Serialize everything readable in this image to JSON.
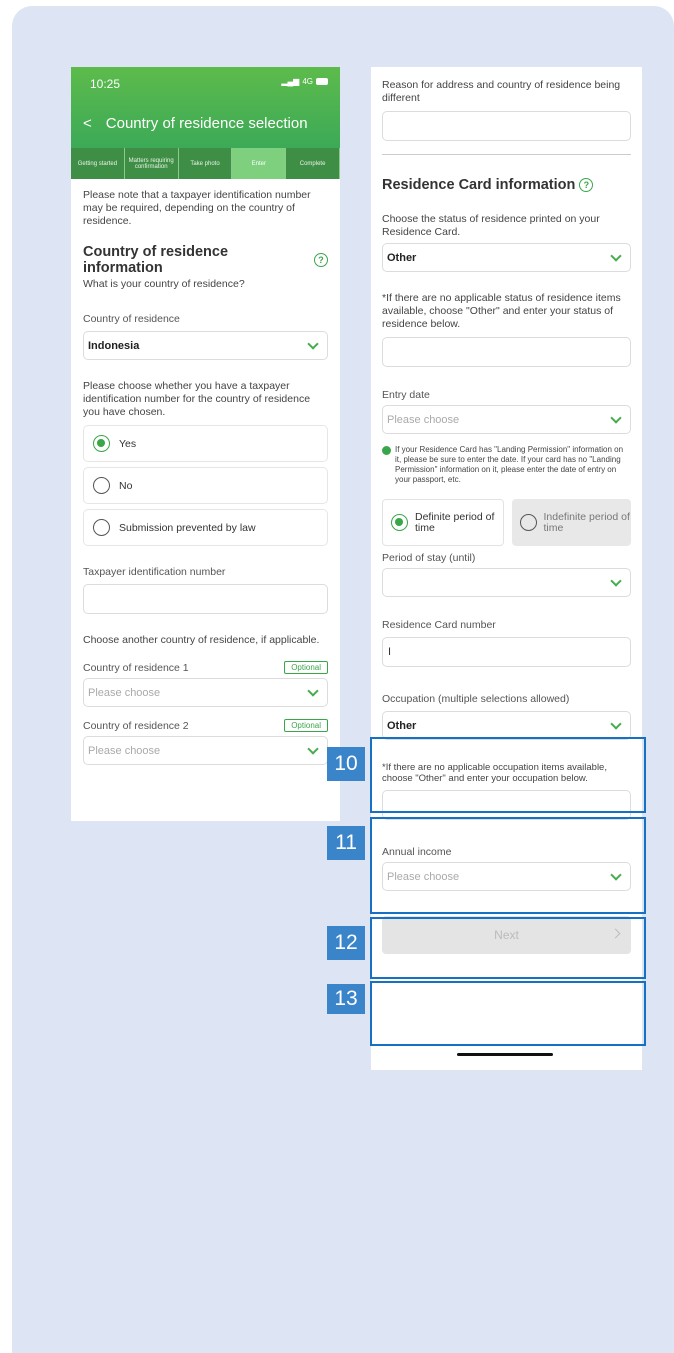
{
  "left_screen": {
    "status_time": "10:25",
    "status_signal": "4G",
    "back_glyph": "<",
    "title": "Country of residence selection",
    "steps": [
      "Getting started",
      "Matters requiring confirmation",
      "Take photo",
      "Enter",
      "Complete"
    ],
    "active_step": 3,
    "notice": "Please note that a taxpayer identification number may be required, depending on the country of residence.",
    "section_title": "Country of residence information",
    "section_question": "What is your country of residence?",
    "country_label": "Country of residence",
    "country_value": "Indonesia",
    "tin_question": "Please choose whether you have a taxpayer identification number for the country of residence you have chosen.",
    "tin_options": [
      "Yes",
      "No",
      "Submission prevented by law"
    ],
    "tin_selected": 0,
    "tin_label": "Taxpayer identification number",
    "tin_value": "",
    "another_country_text": "Choose another country of residence, if applicable.",
    "country1_label": "Country of residence 1",
    "country2_label": "Country of residence 2",
    "optional_label": "Optional",
    "please_choose": "Please choose"
  },
  "right_screen": {
    "reason_label": "Reason for address and country of residence being different",
    "reason_value": "",
    "card_section_title": "Residence Card information",
    "status_instruction": "Choose the status of residence printed on your Residence Card.",
    "status_value": "Other",
    "status_other_note": "*If there are no applicable status of residence items available, choose \"Other\" and enter your status of residence below.",
    "status_other_value": "",
    "entry_date_label": "Entry date",
    "entry_date_placeholder": "Please choose",
    "entry_note": "If your Residence Card has \"Landing Permission\" information on it, please be sure to enter the date. If your card has no \"Landing Permission\" information on it, please enter the date of entry on your passport, etc.",
    "period_definite": "Definite period of time",
    "period_indefinite": "Indefinite period of time",
    "period_stay_label": "Period of stay (until)",
    "period_stay_value": "",
    "card_number_label": "Residence Card number",
    "card_number_value": "I",
    "occupation_label": "Occupation (multiple selections allowed)",
    "occupation_value": "Other",
    "occupation_note": "*If there are no applicable occupation items available, choose \"Other\" and enter your occupation below.",
    "occupation_other_value": "",
    "annual_income_label": "Annual income",
    "annual_income_placeholder": "Please choose",
    "next_label": "Next"
  },
  "callouts": [
    "10",
    "11",
    "12",
    "13"
  ],
  "colors": {
    "brand_green": "#3aa64a",
    "callout_blue": "#1670c4",
    "background": "#dde4f3"
  }
}
